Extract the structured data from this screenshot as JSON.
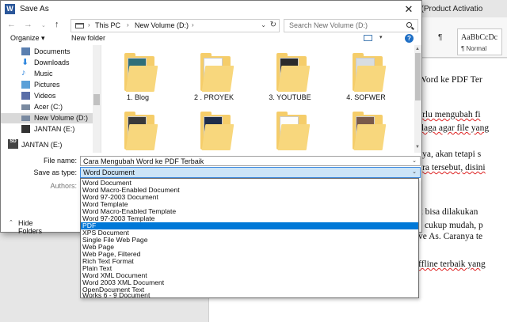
{
  "word": {
    "title_fragment": "Word (Product Activatio",
    "style_preview": "AaBbCcDc",
    "style_name": "¶ Normal",
    "doc_lines": [
      "Word ke PDF Ter",
      "erlu mengubah fi",
      "rlaga agar file yang",
      "aya, akan tetapi s",
      "ara tersebut, disini",
      "k bisa dilakukan",
      "a cukup mudah, p",
      "ve As. Caranya te",
      "ffline terbaik yang"
    ]
  },
  "dialog": {
    "title": "Save As",
    "app_icon": "W",
    "close": "✕",
    "address": {
      "crumbs": [
        "This PC",
        "New Volume (D:)"
      ]
    },
    "search_placeholder": "Search New Volume (D:)",
    "toolbar": {
      "organize": "Organize ▾",
      "new_folder": "New folder",
      "help": "?"
    },
    "nav_items": [
      {
        "label": "Documents",
        "icon": "documents-icon",
        "color": "#5a7fb0"
      },
      {
        "label": "Downloads",
        "icon": "downloads-icon",
        "color": "#2e86de"
      },
      {
        "label": "Music",
        "icon": "music-icon",
        "color": "#2e86de"
      },
      {
        "label": "Pictures",
        "icon": "pictures-icon",
        "color": "#5aa0d8"
      },
      {
        "label": "Videos",
        "icon": "videos-icon",
        "color": "#5a6ea8"
      },
      {
        "label": "Acer (C:)",
        "icon": "drive-c-icon",
        "color": "#7a8aa0"
      },
      {
        "label": "New Volume (D:)",
        "icon": "drive-d-icon",
        "color": "#7a8aa0"
      },
      {
        "label": "JANTAN (E:)",
        "icon": "sd-card-icon",
        "color": "#333333"
      }
    ],
    "nav_drive": {
      "label": "JANTAN (E:)",
      "icon_text": "SD"
    },
    "folders": [
      "1. Blog",
      "2 . PROYEK",
      "3. YOUTUBE",
      "4. SOFWER",
      "",
      "",
      "",
      ""
    ],
    "file_name_label": "File name:",
    "file_name_value": "Cara Mengubah Word ke PDF Terbaik",
    "save_type_label": "Save as type:",
    "save_type_value": "Word Document",
    "authors_label": "Authors:",
    "hide_folders": "Hide Folders",
    "type_options": [
      "Word Document",
      "Word Macro-Enabled Document",
      "Word 97-2003 Document",
      "Word Template",
      "Word Macro-Enabled Template",
      "Word 97-2003 Template",
      "PDF",
      "XPS Document",
      "Single File Web Page",
      "Web Page",
      "Web Page, Filtered",
      "Rich Text Format",
      "Plain Text",
      "Word XML Document",
      "Word 2003 XML Document",
      "OpenDocument Text",
      "Works 6 - 9 Document"
    ],
    "selected_option": "PDF",
    "accent": "#0078d7"
  }
}
